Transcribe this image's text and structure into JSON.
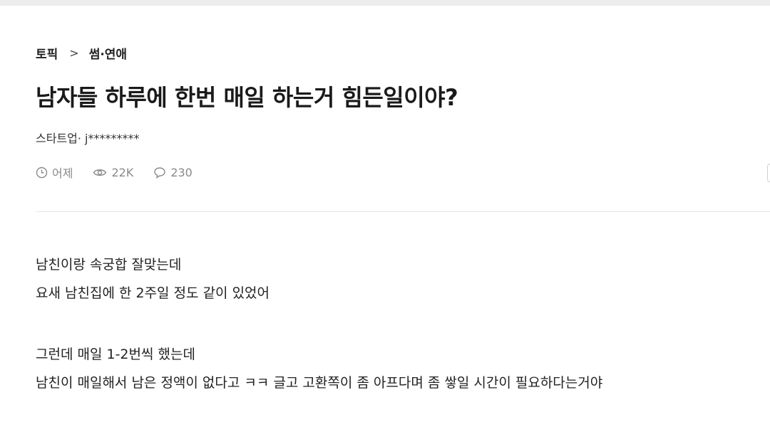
{
  "breadcrumb": {
    "topic": "토픽",
    "separator": ">",
    "category": "썸·연애"
  },
  "post": {
    "title": "남자들 하루에 한번 매일 하는거 힘든일이야?",
    "author": "스타트업· j*********",
    "meta": {
      "time_icon": "clock-icon",
      "time": "어제",
      "views_icon": "eye-icon",
      "views": "22K",
      "comments_icon": "comment-icon",
      "comments": "230"
    },
    "body": {
      "line1": "남친이랑 속궁합 잘맞는데",
      "line2": "요새 남친집에 한 2주일 정도 같이 있었어",
      "line3": "그런데 매일 1-2번씩 했는데",
      "line4": "남친이 매일해서 남은 정액이 없다고 ㅋㅋ 글고 고환쪽이 좀 아프다며 좀 쌓일 시간이 필요하다는거야"
    }
  }
}
